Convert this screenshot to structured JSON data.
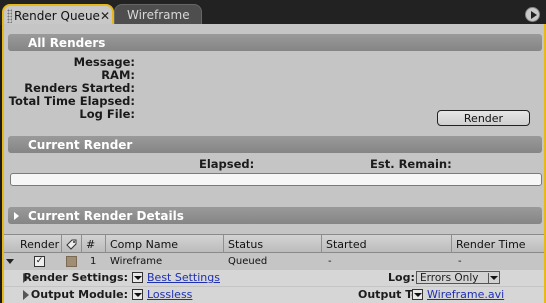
{
  "tabs": [
    {
      "label": "Render Queue",
      "active": true,
      "close": "✕"
    },
    {
      "label": "Wireframe",
      "active": false
    }
  ],
  "all_renders": {
    "title": "All Renders",
    "labels": {
      "message": "Message:",
      "ram": "RAM:",
      "renders_started": "Renders Started:",
      "total_time": "Total Time Elapsed:",
      "log_file": "Log File:"
    },
    "render_button": "Render"
  },
  "current_render": {
    "title": "Current Render",
    "elapsed_label": "Elapsed:",
    "remain_label": "Est. Remain:",
    "progress": 0
  },
  "details": {
    "title": "Current Render Details"
  },
  "table": {
    "columns": [
      "Render",
      "",
      "#",
      "Comp Name",
      "Status",
      "Started",
      "Render Time"
    ],
    "row": {
      "checked": "✓",
      "number": "1",
      "comp_name": "Wireframe",
      "status": "Queued",
      "started": "-",
      "render_time": "-"
    }
  },
  "render_settings": {
    "label": "Render Settings:",
    "value": "Best Settings",
    "log_label": "Log:",
    "log_value": "Errors Only"
  },
  "output_module": {
    "label": "Output Module:",
    "value": "Lossless",
    "output_to_label": "Output To:",
    "output_to_value": "Wireframe.avi"
  },
  "colors": {
    "accent": "#e8b818",
    "panel": "#c5c5c5",
    "header": "#8f8f8f",
    "link": "#1d2fb0",
    "label_swatch": "#a08e74"
  }
}
